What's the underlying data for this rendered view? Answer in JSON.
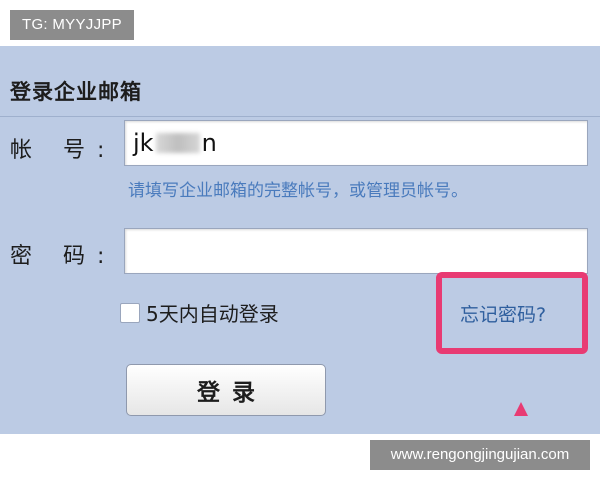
{
  "badge": {
    "text": "TG: MYYJJPP"
  },
  "login": {
    "title": "登录企业邮箱",
    "account_label": "帐 号:",
    "account_value_prefix": "jk",
    "account_value_suffix": "n",
    "account_hint": "请填写企业邮箱的完整帐号，或管理员帐号。",
    "password_label": "密 码:",
    "password_value": "",
    "remember_label": "5天内自动登录",
    "remember_checked": false,
    "forgot_label": "忘记密码?",
    "submit_label": "登录"
  },
  "colors": {
    "panel_bg": "#bccbe4",
    "highlight": "#e83b73",
    "hint": "#4a7bbd",
    "link": "#2f5f9e"
  },
  "watermark": {
    "text": "www.rengongjingujian.com"
  }
}
